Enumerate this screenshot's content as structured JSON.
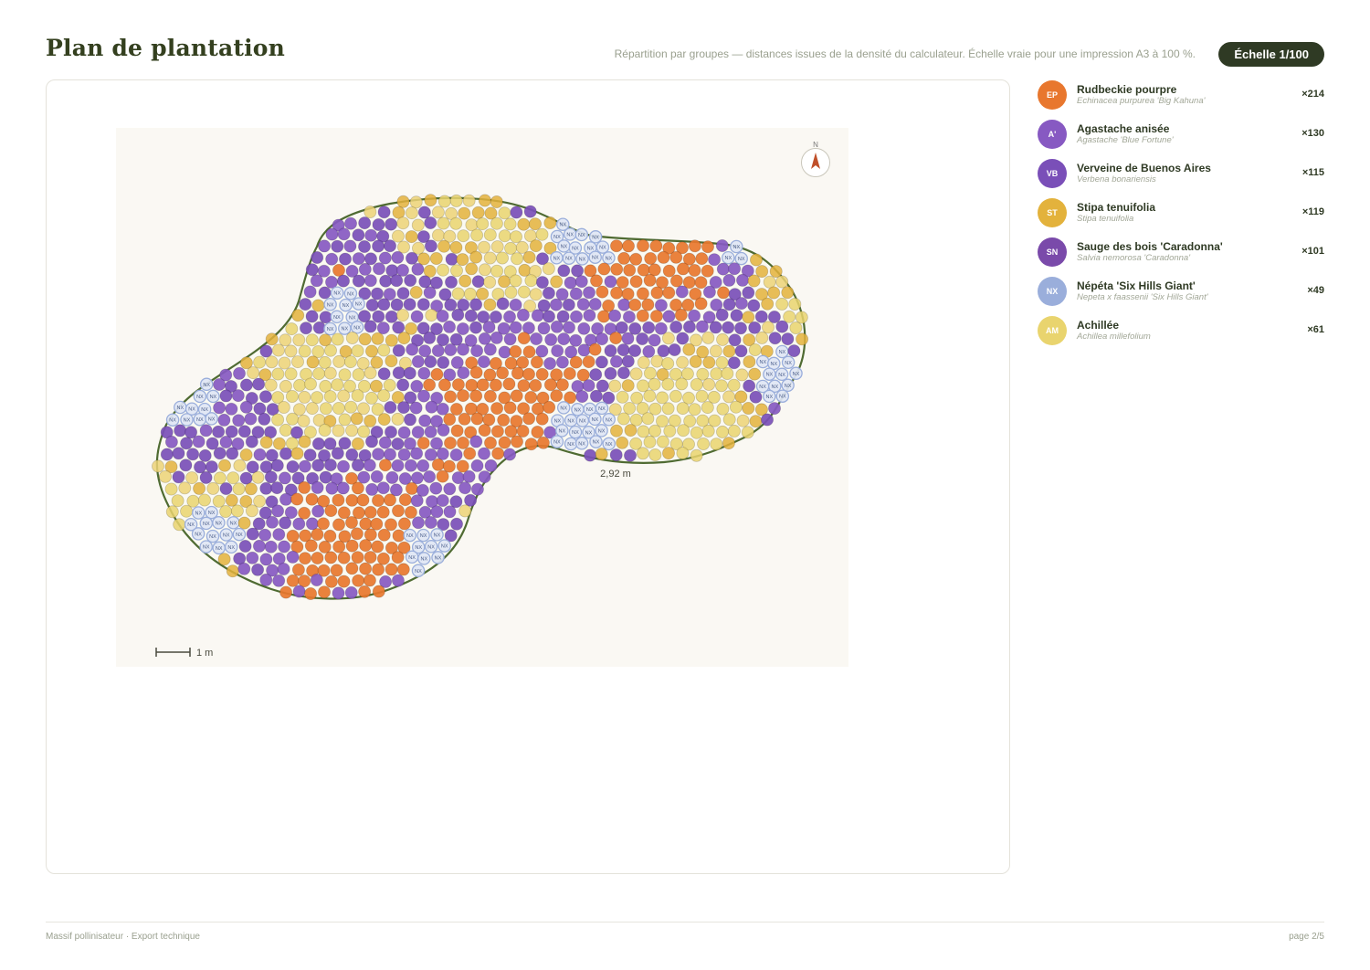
{
  "header": {
    "title": "Plan de plantation",
    "subtitle": "Répartition par groupes — distances issues de la densité du calculateur. Échelle vraie pour une impression A3 à 100 %.",
    "scale_badge": "Échelle 1/100"
  },
  "plan": {
    "north_label": "N",
    "dimension_label": "2,92 m",
    "scale_bar_label": "1 m",
    "colors": {
      "background": "#faf8f3",
      "border": "#4f6b32",
      "fill": "#fbfaf2"
    }
  },
  "legend": [
    {
      "code": "EP",
      "name": "Rudbeckie pourpre",
      "latin": "Echinacea purpurea 'Big Kahuna'",
      "count": "×214",
      "color": "#e8772e"
    },
    {
      "code": "A'",
      "name": "Agastache anisée",
      "latin": "Agastache 'Blue Fortune'",
      "count": "×130",
      "color": "#8759c2"
    },
    {
      "code": "VB",
      "name": "Verveine de Buenos Aires",
      "latin": "Verbena bonariensis",
      "count": "×115",
      "color": "#7a4fb8"
    },
    {
      "code": "ST",
      "name": "Stipa tenuifolia",
      "latin": "Stipa tenuifolia",
      "count": "×119",
      "color": "#e3b23c"
    },
    {
      "code": "SN",
      "name": "Sauge des bois 'Caradonna'",
      "latin": "Salvia nemorosa 'Caradonna'",
      "count": "×101",
      "color": "#7a4aaa"
    },
    {
      "code": "NX",
      "name": "Népéta 'Six Hills Giant'",
      "latin": "Nepeta x faassenii 'Six Hills Giant'",
      "count": "×49",
      "color": "#9aaedb"
    },
    {
      "code": "AM",
      "name": "Achillée",
      "latin": "Achillea millefolium",
      "count": "×61",
      "color": "#e9d46e"
    }
  ],
  "footer": {
    "left": "Massif pollinisateur · Export technique",
    "right": "page 2/5"
  }
}
